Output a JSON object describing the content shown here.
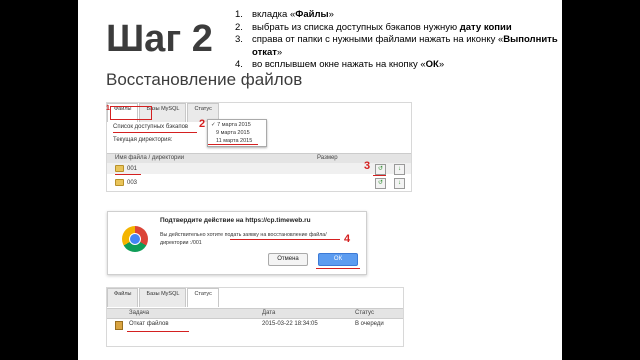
{
  "step": {
    "title": "Шаг 2"
  },
  "steps": [
    {
      "num": "1.",
      "pre": "вкладка «",
      "bold": "Файлы",
      "post": "»"
    },
    {
      "num": "2.",
      "pre": "выбрать из списка доступных бэкапов нужную ",
      "bold": "дату копии",
      "post": ""
    },
    {
      "num": "3.",
      "pre": "справа от папки с нужными файлами нажать на иконку «",
      "bold": "Выполнить откат",
      "post": "»"
    },
    {
      "num": "4.",
      "pre": "во всплывшем окне нажать на кнопку «",
      "bold": "ОК",
      "post": "»"
    }
  ],
  "subtitle": "Восстановление файлов",
  "shot1": {
    "tabs": [
      "Файлы",
      "Базы MySQL",
      "Статус"
    ],
    "backup_list_label": "Список доступных бэкапов",
    "current_dir_label": "Текущая директория:",
    "dates": [
      "7 марта 2015",
      "9 марта 2015",
      "11 марта 2015"
    ],
    "selected_mark": "✓",
    "col_name": "Имя файла / директории",
    "col_size": "Размер",
    "rows": [
      {
        "name": "001"
      },
      {
        "name": "003"
      }
    ],
    "marker1": "1",
    "marker2": "2",
    "marker3": "3"
  },
  "dialog": {
    "title": "Подтвердите действие на https://cp.timeweb.ru",
    "text_line1": "Вы действительно хотите подать заявку на восстановление файла/",
    "text_line2": "директории :/001",
    "cancel": "Отмена",
    "ok": "ОК",
    "marker4": "4"
  },
  "shot2": {
    "tabs": [
      "Файлы",
      "Базы MySQL",
      "Статус"
    ],
    "col_task": "Задача",
    "col_date": "Дата",
    "col_status": "Статус",
    "row": {
      "task": "Откат файлов",
      "date": "2015-03-22 18:34:05",
      "status": "В очереди"
    }
  }
}
